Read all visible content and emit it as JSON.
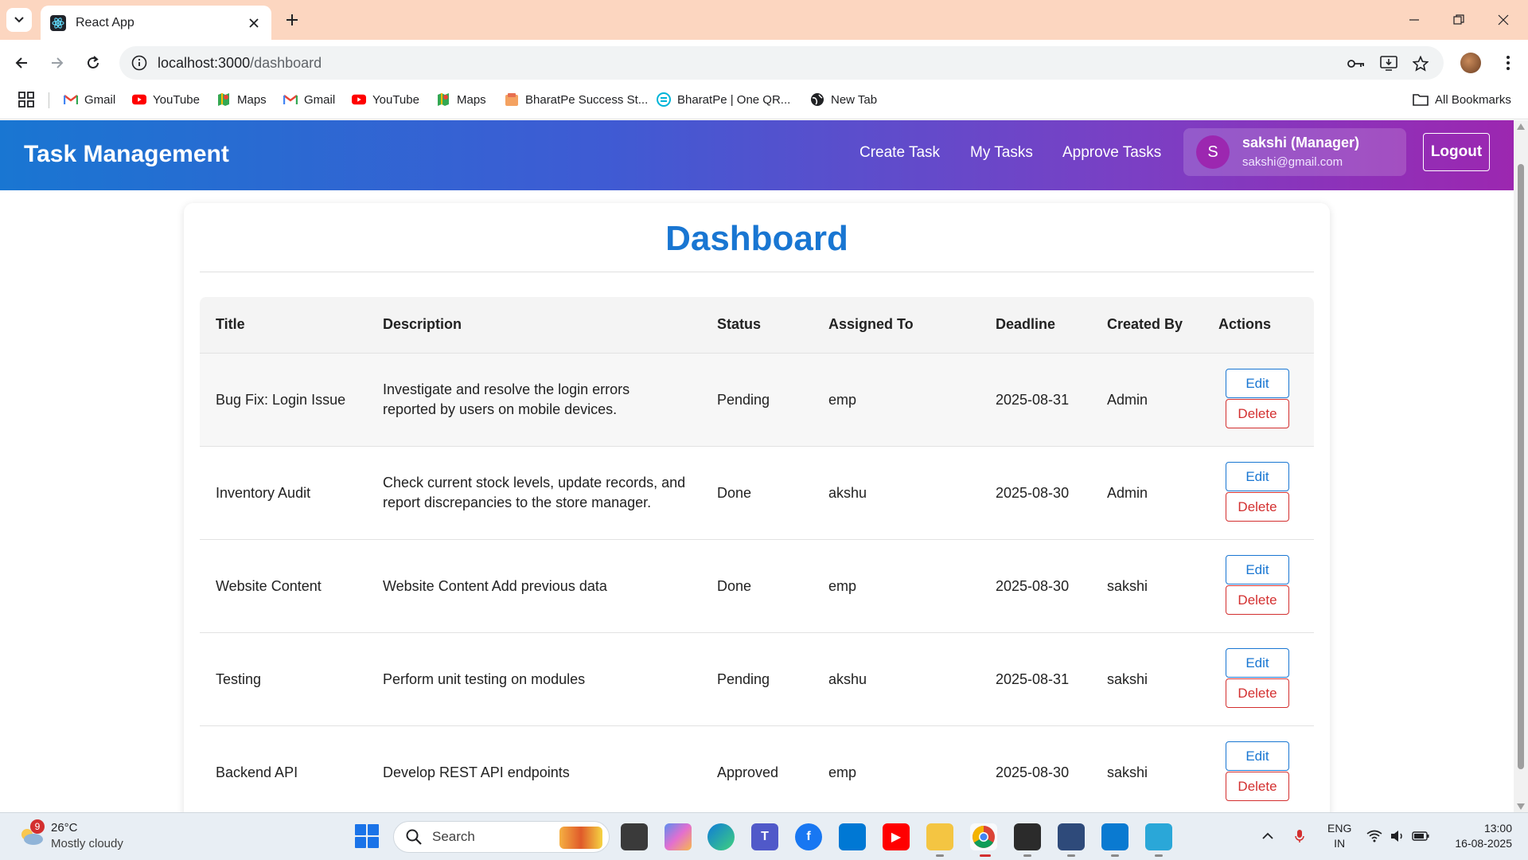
{
  "browser": {
    "tab_title": "React App",
    "url_host": "localhost:3000",
    "url_path": "/dashboard",
    "bookmarks": [
      "Gmail",
      "YouTube",
      "Maps",
      "Gmail",
      "YouTube",
      "Maps",
      "BharatPe Success St...",
      "BharatPe | One QR...",
      "New Tab"
    ],
    "all_bookmarks": "All Bookmarks"
  },
  "header": {
    "title": "Task Management",
    "nav": [
      "Create Task",
      "My Tasks",
      "Approve Tasks"
    ],
    "user_initial": "S",
    "user_name": "sakshi (Manager)",
    "user_email": "sakshi@gmail.com",
    "logout": "Logout"
  },
  "dashboard": {
    "title": "Dashboard",
    "columns": [
      "Title",
      "Description",
      "Status",
      "Assigned To",
      "Deadline",
      "Created By",
      "Actions"
    ],
    "edit_label": "Edit",
    "delete_label": "Delete",
    "rows": [
      {
        "title": "Bug Fix: Login Issue",
        "desc1": "Investigate and resolve the login errors",
        "desc2": "reported by users on mobile devices.",
        "status": "Pending",
        "assigned": "emp",
        "deadline": "2025-08-31",
        "created_by": "Admin"
      },
      {
        "title": "Inventory Audit",
        "desc1": "Check current stock levels, update records, and",
        "desc2": "report discrepancies to the store manager.",
        "status": "Done",
        "assigned": "akshu",
        "deadline": "2025-08-30",
        "created_by": "Admin"
      },
      {
        "title": "Website Content",
        "desc1": "Website Content Add previous data",
        "desc2": "",
        "status": "Done",
        "assigned": "emp",
        "deadline": "2025-08-30",
        "created_by": "sakshi"
      },
      {
        "title": "Testing",
        "desc1": "Perform unit testing on modules",
        "desc2": "",
        "status": "Pending",
        "assigned": "akshu",
        "deadline": "2025-08-31",
        "created_by": "sakshi"
      },
      {
        "title": "Backend API",
        "desc1": "Develop REST API endpoints",
        "desc2": "",
        "status": "Approved",
        "assigned": "emp",
        "deadline": "2025-08-30",
        "created_by": "sakshi"
      }
    ]
  },
  "taskbar": {
    "weather_badge": "9",
    "weather_temp": "26°C",
    "weather_desc": "Mostly cloudy",
    "search": "Search",
    "lang1": "ENG",
    "lang2": "IN",
    "time": "13:00",
    "date": "16-08-2025"
  },
  "colors": {
    "header_gradient_start": "#1976d2",
    "header_gradient_end": "#9c27b0",
    "dashboard_title": "#1976d2",
    "edit": "#1976d2",
    "delete": "#d32f2f"
  }
}
